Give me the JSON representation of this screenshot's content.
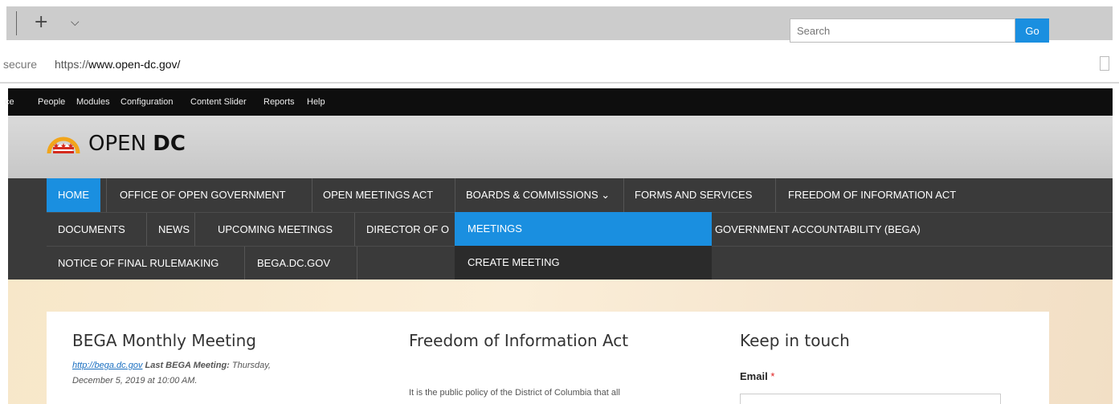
{
  "browser": {
    "new_tab_symbol": "+",
    "tab_list_symbol": "⌵",
    "address_prefix": "secure",
    "url_scheme": "https://",
    "url_host": "www.open-dc.gov/"
  },
  "admin_toolbar": {
    "items": [
      "ce",
      "People",
      "Modules",
      "Configuration",
      "Content Slider",
      "Reports",
      "Help"
    ]
  },
  "header": {
    "site_name_light": "OPEN ",
    "site_name_bold": "DC",
    "search_placeholder": "Search",
    "search_button": "Go",
    "logo_icon": "dc-flag-sunrise-icon"
  },
  "nav": {
    "row1": [
      "HOME",
      "OFFICE OF OPEN GOVERNMENT",
      "OPEN MEETINGS ACT",
      "BOARDS & COMMISSIONS ⌄",
      "FORMS AND SERVICES",
      "FREEDOM OF INFORMATION ACT"
    ],
    "row2": [
      "DOCUMENTS",
      "NEWS",
      "UPCOMING MEETINGS",
      "DIRECTOR OF O",
      ") GOVERNMENT ACCOUNTABILITY (BEGA)"
    ],
    "row3": [
      "NOTICE OF FINAL RULEMAKING",
      "BEGA.DC.GOV"
    ],
    "dropdown": [
      "MEETINGS",
      "CREATE MEETING"
    ]
  },
  "content": {
    "col1": {
      "title": "BEGA Monthly Meeting",
      "link": "http://bega.dc.gov",
      "meta_bold": " Last BEGA Meeting:",
      "meta_rest": " Thursday,",
      "meta_line2": "December 5, 2019 at 10:00 AM."
    },
    "col2": {
      "title": "Freedom of Information Act",
      "body": "It is the public policy of the District of Columbia that all"
    },
    "col3": {
      "title": "Keep in touch",
      "email_label": "Email",
      "required_mark": "*"
    }
  },
  "colors": {
    "accent": "#1a8fe0",
    "admin_bg": "#0e0e0e",
    "nav_bg": "#3a3a3a"
  }
}
